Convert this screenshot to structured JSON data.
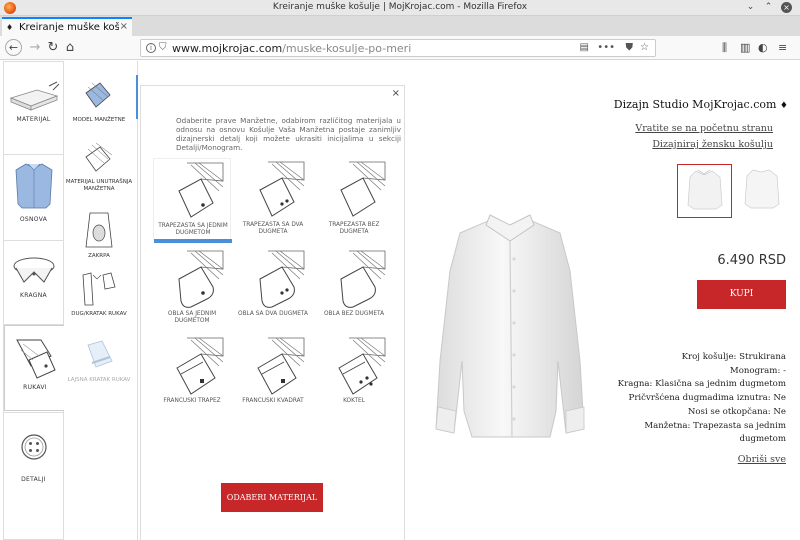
{
  "window": {
    "title": "Kreiranje muške košulje | MojKrojac.com - Mozilla Firefox"
  },
  "tab": {
    "label": "Kreiranje muške koš",
    "new_tab": "+"
  },
  "nav": {
    "url_domain": "www.mojkrojac.com",
    "url_path": "/muske-kosulje-po-meri"
  },
  "sidebar": {
    "categories": [
      {
        "label": "MATERIJAL",
        "icon": "fabric-icon"
      },
      {
        "label": "OSNOVA",
        "icon": "shirt-icon"
      },
      {
        "label": "KRAGNA",
        "icon": "collar-icon"
      },
      {
        "label": "RUKAVI",
        "icon": "sleeve-icon"
      },
      {
        "label": "DETALJI",
        "icon": "button-icon"
      }
    ],
    "subitems": [
      {
        "label": "MODEL MANŽETNE",
        "icon": "cuff-model-icon"
      },
      {
        "label": "MATERIJAL UNUTRAŠNJA MANŽETNA",
        "icon": "inner-cuff-fabric-icon"
      },
      {
        "label": "ZAKRPA",
        "icon": "elbow-patch-icon"
      },
      {
        "label": "DUG/KRATAK RUKAV",
        "icon": "sleeve-length-icon"
      },
      {
        "label": "LAJSNA KRATAK RUKAV",
        "icon": "short-sleeve-trim-icon"
      }
    ]
  },
  "panel": {
    "close": "×",
    "description": "Odaberite prave Manžetne, odabirom različitog materijala u odnosu na osnovu Košulje Vaša Manžetna postaje zanimljiv dizajnerski detalj koji možete ukrasiti inicijalima u sekciji Detalji/Monogram.",
    "options": [
      {
        "label": "TRAPEZASTA SA JEDNIM DUGMETOM",
        "selected": true
      },
      {
        "label": "TRAPEZASTA SA DVA DUGMETA",
        "selected": false
      },
      {
        "label": "TRAPEZASTA BEZ DUGMETA",
        "selected": false
      },
      {
        "label": "OBLA SA JEDNIM DUGMETOM",
        "selected": false
      },
      {
        "label": "OBLA SA DVA DUGMETA",
        "selected": false
      },
      {
        "label": "OBLA BEZ DUGMETA",
        "selected": false
      },
      {
        "label": "FRANCUSKI TRAPEZ",
        "selected": false
      },
      {
        "label": "FRANCUSKI KVADRAT",
        "selected": false
      },
      {
        "label": "KOKTEL",
        "selected": false
      }
    ],
    "select_material_label": "ODABERI MATERIJAL"
  },
  "info": {
    "studio": "Dizajn Studio MojKrojac.com",
    "home_link": "Vratite se na početnu stranu",
    "women_link": "Dizajniraj žensku košulju",
    "price": "6.490 RSD",
    "buy_label": "KUPI",
    "specs": [
      "Kroj košulje: Strukirana",
      "Monogram: -",
      "Kragna: Klasična sa jednim dugmetom",
      "Pričvršćena dugmadima iznutra: Ne",
      "Nosi se otkopčana: Ne",
      "Manžetna: Trapezasta sa jednim",
      "dugmetom"
    ],
    "clear_link": "Obriši sve"
  },
  "colors": {
    "accent_red": "#c8272a",
    "accent_blue": "#4a90d9"
  }
}
